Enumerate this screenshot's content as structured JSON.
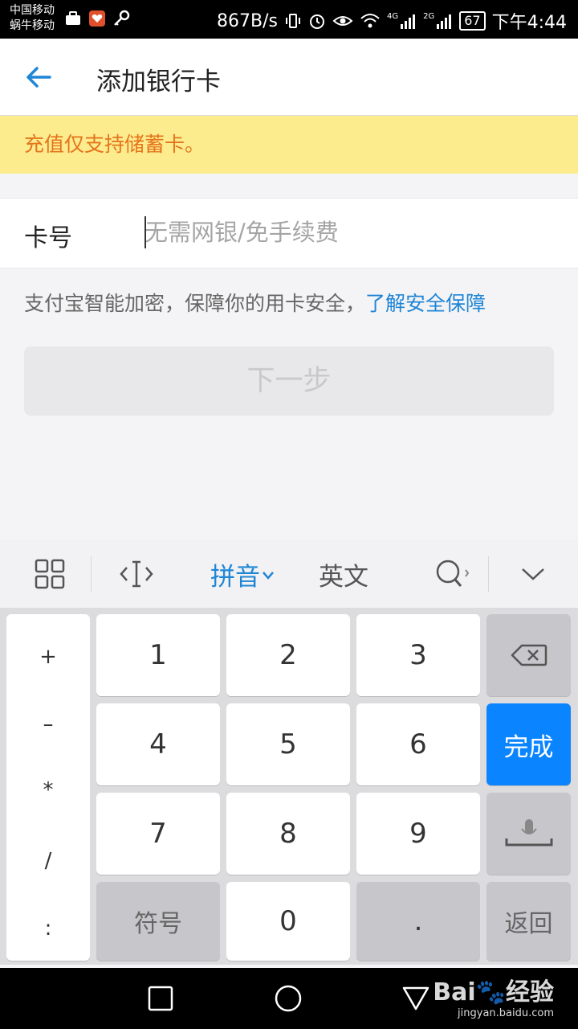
{
  "status_bar": {
    "carrier_1": "中国移动",
    "carrier_2": "蜗牛移动",
    "net_speed": "867B/s",
    "net_4g": "4G",
    "net_2g": "2G",
    "battery": "67",
    "time": "下午4:44"
  },
  "app_bar": {
    "back_icon": "arrow-left-icon",
    "title": "添加银行卡"
  },
  "notice": {
    "text": "充值仅支持储蓄卡。",
    "bg_color": "#fcec8e",
    "text_color": "#e5741c"
  },
  "card_field": {
    "label": "卡号",
    "placeholder": "无需网银/免手续费",
    "value": ""
  },
  "security": {
    "text": "支付宝智能加密，保障你的用卡安全，",
    "link": "了解安全保障"
  },
  "next_button": {
    "label": "下一步"
  },
  "ime_toolbar": {
    "pinyin": "拼音",
    "english": "英文"
  },
  "keyboard": {
    "symbols": [
      "+",
      "–",
      "*",
      "/",
      ":"
    ],
    "digits": [
      "1",
      "2",
      "3",
      "4",
      "5",
      "6",
      "7",
      "8",
      "9",
      "0"
    ],
    "symbol_key": "符号",
    "dot_key": ".",
    "done_key": "完成",
    "return_key": "返回",
    "accent_color": "#0a84ff"
  },
  "watermark": {
    "main": "Bai🐾经验",
    "sub": "jingyan.baidu.com"
  }
}
